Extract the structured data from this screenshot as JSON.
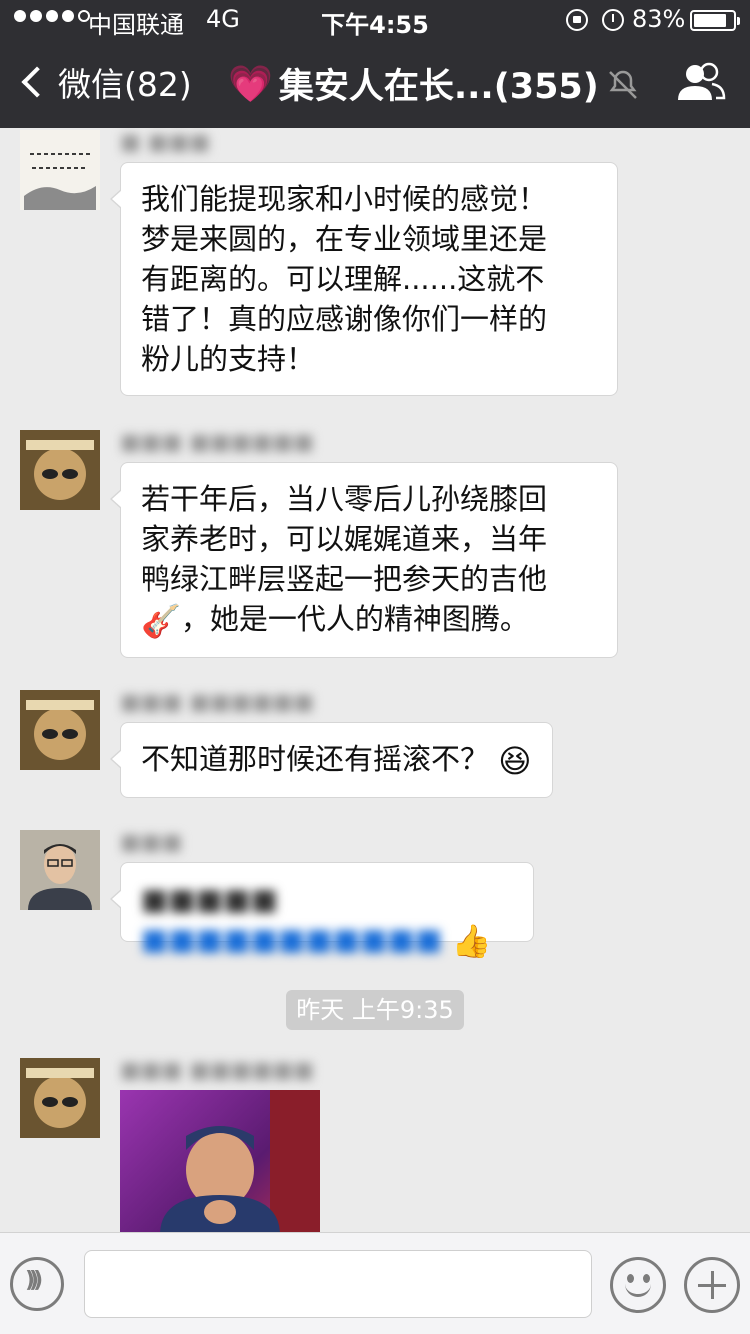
{
  "status_bar": {
    "carrier": "中国联通",
    "network": "4G",
    "time": "下午4:55",
    "battery_percent": "83%",
    "battery_level": 0.83
  },
  "nav": {
    "back_label": "微信(82)",
    "title_emoji": "💗",
    "title": "集安人在长...(355)"
  },
  "messages": [
    {
      "text_lines": [
        "我们能提现家和小时候的感觉！",
        "梦是来圆的，在专业领域里还是",
        "有距离的。可以理解......这就不",
        "错了！真的应感谢像你们一样的",
        "粉儿的支持！"
      ]
    },
    {
      "text_lines": [
        "若干年后，当八零后儿孙绕膝回",
        "家养老时，可以娓娓道来，当年",
        "鸭绿江畔层竖起一把参天的吉他"
      ],
      "last_line_emoji": "🎸",
      "last_line_text": "，她是一代人的精神图腾。"
    },
    {
      "text": "不知道那时候还有摇滚不？",
      "emoji": "😆"
    },
    {
      "emoji": "👍"
    }
  ],
  "timestamp": "昨天 上午9:35",
  "input": {
    "value": ""
  }
}
